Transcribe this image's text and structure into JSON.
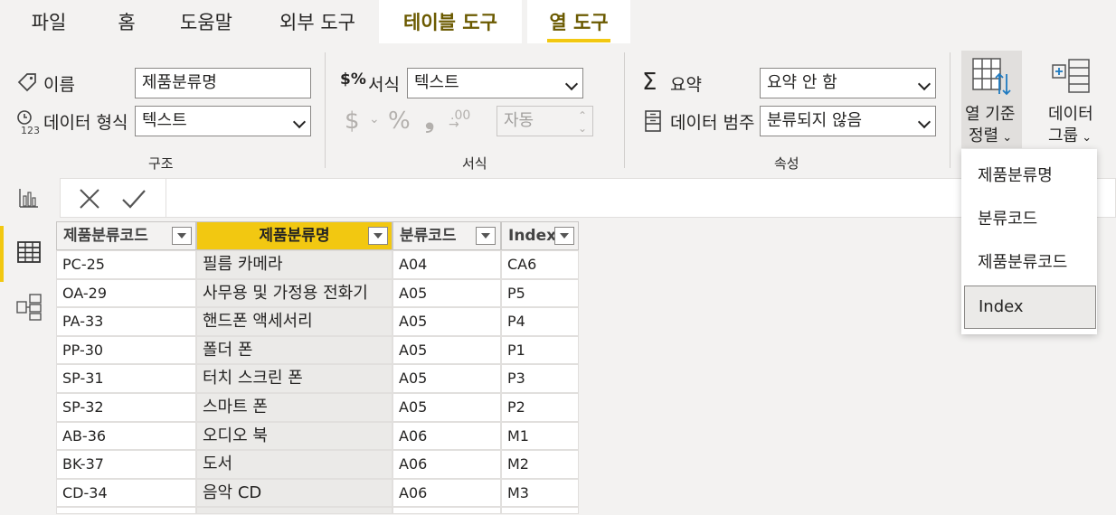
{
  "tabs": [
    {
      "label": "파일"
    },
    {
      "label": "홈"
    },
    {
      "label": "도움말"
    },
    {
      "label": "외부 도구"
    },
    {
      "label": "테이블 도구"
    },
    {
      "label": "열 도구"
    }
  ],
  "ribbon": {
    "structure": {
      "group_label": "구조",
      "name_label": "이름",
      "name_value": "제품분류명",
      "datatype_label": "데이터 형식",
      "datatype_value": "텍스트"
    },
    "format": {
      "group_label": "서식",
      "format_label": "서식",
      "format_value": "텍스트",
      "currency_symbol": "$",
      "percent_symbol": "%",
      "comma_symbol": "❟",
      "decimals_symbol": ".00",
      "auto_value": "자동"
    },
    "properties": {
      "group_label": "속성",
      "summary_label": "요약",
      "summary_value": "요약 안 함",
      "category_label": "데이터 범주",
      "category_value": "분류되지 않음"
    },
    "sort_by_column": {
      "line1": "열 기준",
      "line2": "정렬"
    },
    "data_groups": {
      "line1": "데이터",
      "line2": "그룹"
    }
  },
  "table": {
    "columns": [
      "제품분류코드",
      "제품분류명",
      "분류코드",
      "Index"
    ],
    "rows": [
      [
        "PC-25",
        "필름 카메라",
        "A04",
        "CA6"
      ],
      [
        "OA-29",
        "사무용 및 가정용 전화기",
        "A05",
        "P5"
      ],
      [
        "PA-33",
        "핸드폰 액세서리",
        "A05",
        "P4"
      ],
      [
        "PP-30",
        "폴더 폰",
        "A05",
        "P1"
      ],
      [
        "SP-31",
        "터치 스크린 폰",
        "A05",
        "P3"
      ],
      [
        "SP-32",
        "스마트 폰",
        "A05",
        "P2"
      ],
      [
        "AB-36",
        "오디오 북",
        "A06",
        "M1"
      ],
      [
        "BK-37",
        "도서",
        "A06",
        "M2"
      ],
      [
        "CD-34",
        "음악 CD",
        "A06",
        "M3"
      ]
    ]
  },
  "sort_dropdown": {
    "items": [
      "제품분류명",
      "분류코드",
      "제품분류코드",
      "Index"
    ],
    "selected": "Index"
  },
  "colors": {
    "accent": "#f2c811",
    "context_tab_text": "#6b5a00",
    "ribbon_bg": "#f3f2f1"
  }
}
